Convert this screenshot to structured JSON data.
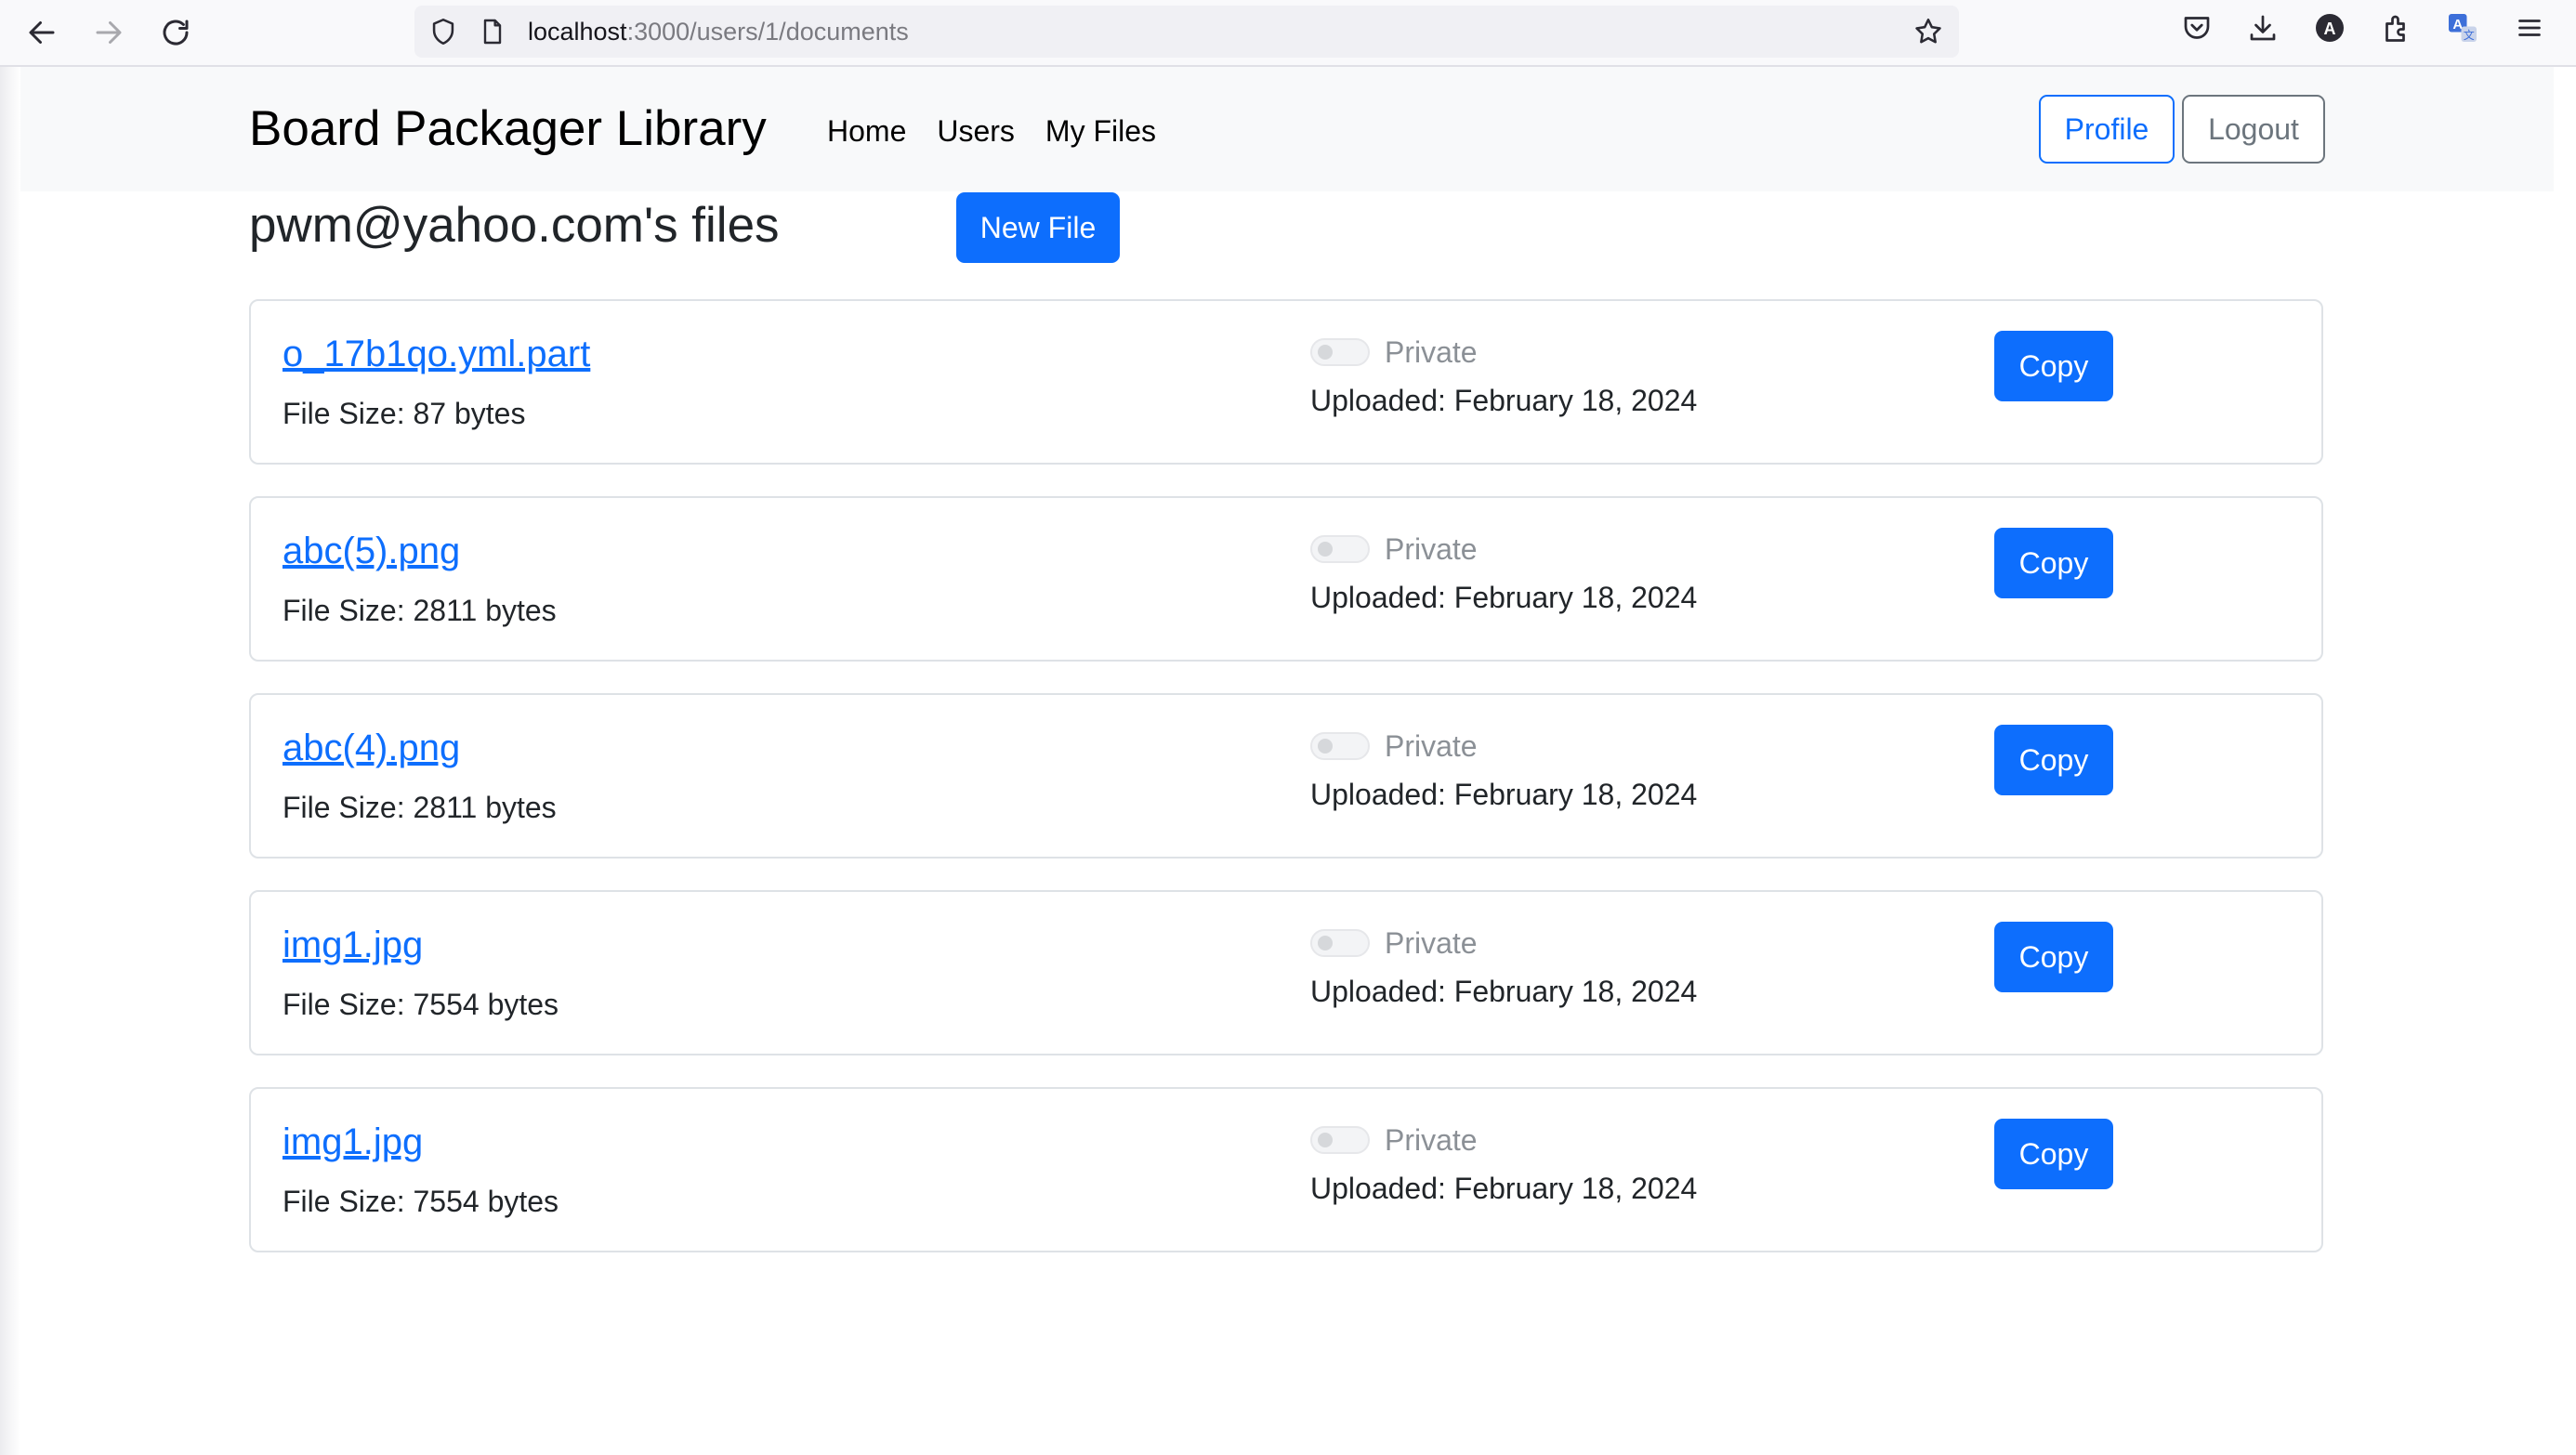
{
  "browser": {
    "url_host": "localhost",
    "url_path": ":3000/users/1/documents",
    "icons": [
      "back-arrow-icon",
      "forward-arrow-icon",
      "reload-icon",
      "shield-icon",
      "page-icon",
      "bookmark-star-icon",
      "pocket-icon",
      "download-icon",
      "account-icon",
      "extensions-icon",
      "translate-icon",
      "menu-icon"
    ]
  },
  "navbar": {
    "brand": "Board Packager Library",
    "links": [
      "Home",
      "Users",
      "My Files"
    ],
    "profile_label": "Profile",
    "logout_label": "Logout"
  },
  "page": {
    "heading": "pwm@yahoo.com's files",
    "new_file_label": "New File"
  },
  "files": [
    {
      "name": "o_17b1qo.yml.part",
      "size": "File Size: 87 bytes",
      "visibility": "Private",
      "uploaded": "Uploaded: February 18, 2024",
      "copy_label": "Copy"
    },
    {
      "name": "abc(5).png",
      "size": "File Size: 2811 bytes",
      "visibility": "Private",
      "uploaded": "Uploaded: February 18, 2024",
      "copy_label": "Copy"
    },
    {
      "name": "abc(4).png",
      "size": "File Size: 2811 bytes",
      "visibility": "Private",
      "uploaded": "Uploaded: February 18, 2024",
      "copy_label": "Copy"
    },
    {
      "name": "img1.jpg",
      "size": "File Size: 7554 bytes",
      "visibility": "Private",
      "uploaded": "Uploaded: February 18, 2024",
      "copy_label": "Copy"
    },
    {
      "name": "img1.jpg",
      "size": "File Size: 7554 bytes",
      "visibility": "Private",
      "uploaded": "Uploaded: February 18, 2024",
      "copy_label": "Copy"
    }
  ],
  "colors": {
    "primary": "#0d6efd",
    "secondary": "#6c757d",
    "navbar_bg": "#f8f9fa",
    "card_border": "#dee2e6"
  }
}
